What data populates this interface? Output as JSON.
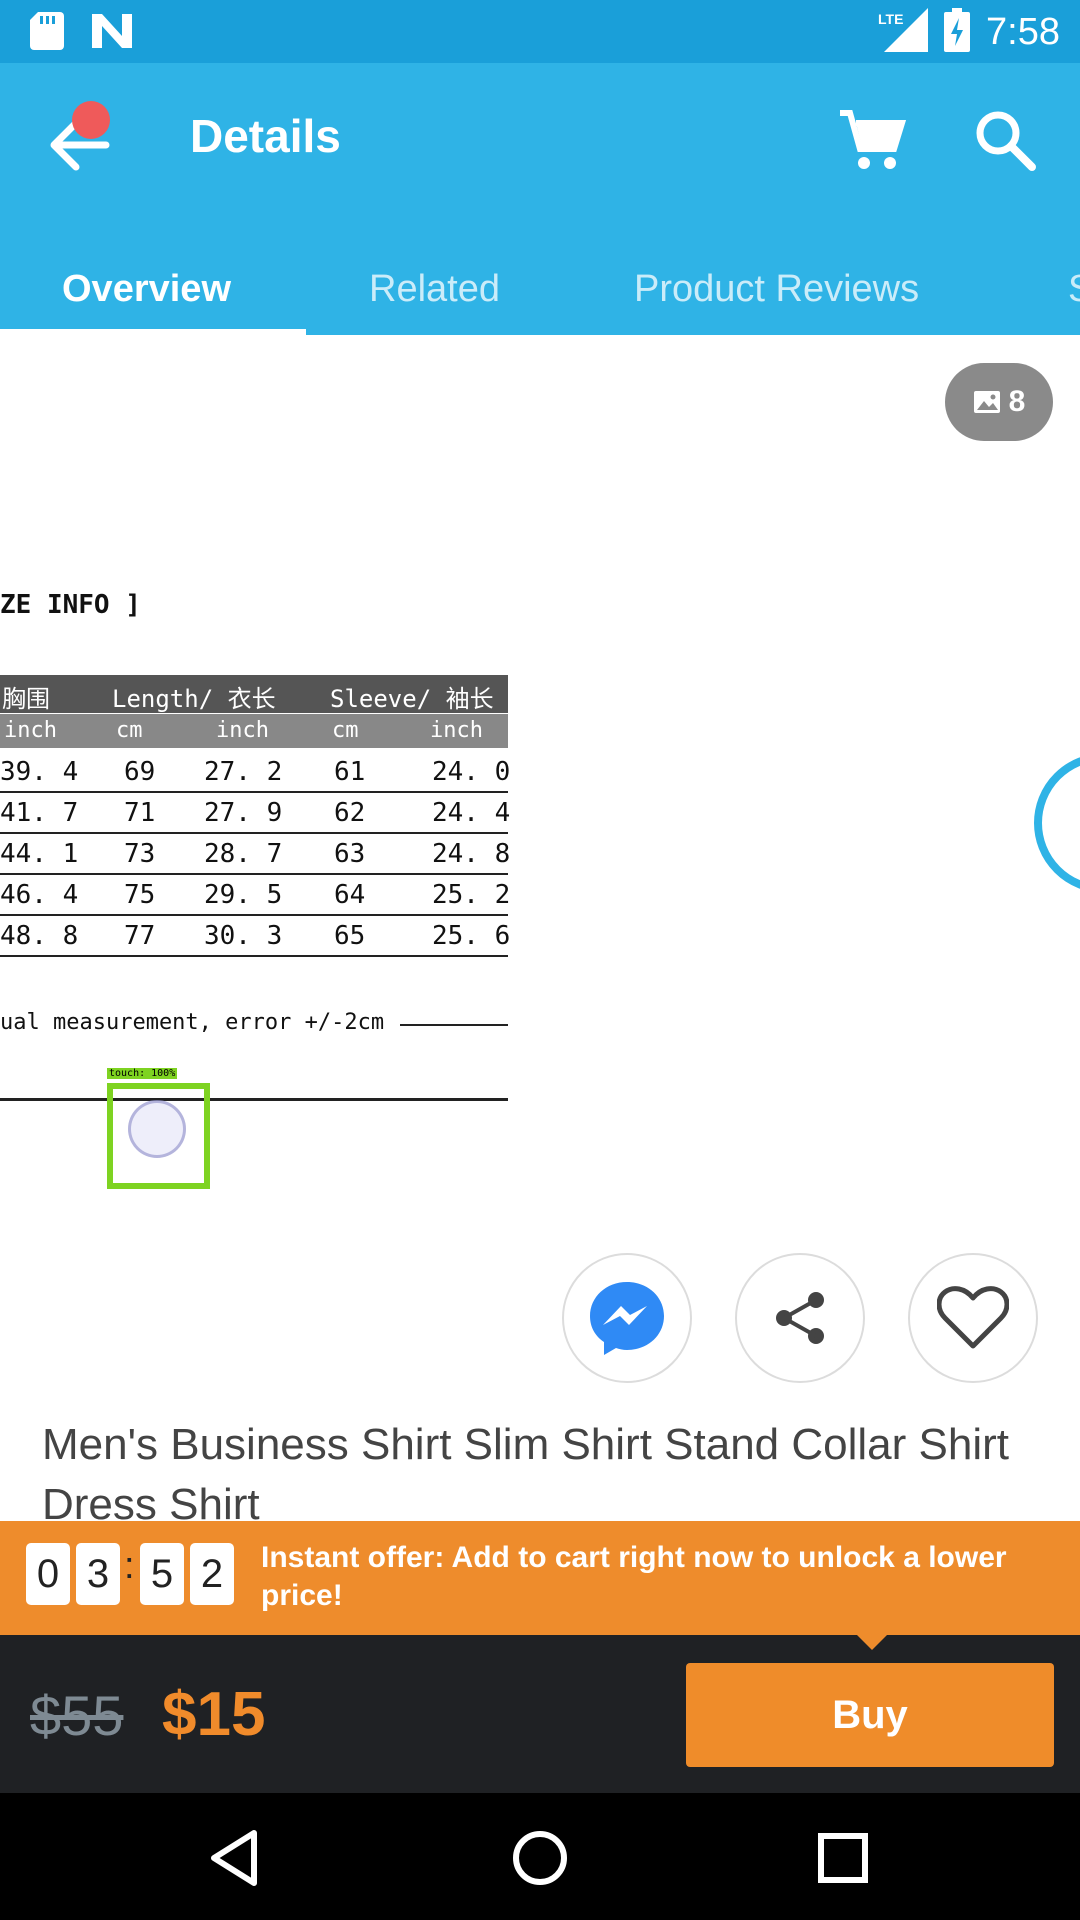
{
  "status_bar": {
    "time": "7:58",
    "network": "LTE",
    "icons": [
      "sd-card-icon",
      "n-notification-icon",
      "signal-icon",
      "battery-charging-icon"
    ]
  },
  "app_bar": {
    "title": "Details",
    "icons": [
      "back-arrow-icon",
      "cart-icon",
      "search-icon"
    ]
  },
  "tabs": [
    {
      "label": "Overview",
      "active": true
    },
    {
      "label": "Related",
      "active": false
    },
    {
      "label": "Product Reviews",
      "active": false
    },
    {
      "label": "S",
      "active": false
    }
  ],
  "gallery": {
    "image_count": "8"
  },
  "size_chart": {
    "title": "ZE INFO ]",
    "header1": [
      "胸围",
      "Length/ 衣长",
      "Sleeve/ 袖长"
    ],
    "header2": [
      "inch",
      "cm",
      "inch",
      "cm",
      "inch"
    ],
    "rows": [
      [
        "39. 4",
        "69",
        "27. 2",
        "61",
        "24. 0"
      ],
      [
        "41. 7",
        "71",
        "27. 9",
        "62",
        "24. 4"
      ],
      [
        "44. 1",
        "73",
        "28. 7",
        "63",
        "24. 8"
      ],
      [
        "46. 4",
        "75",
        "29. 5",
        "64",
        "25. 2"
      ],
      [
        "48. 8",
        "77",
        "30. 3",
        "65",
        "25. 6"
      ]
    ],
    "note": "ual measurement, error +/-2cm"
  },
  "touch_overlay": {
    "label": "touch: 100%"
  },
  "actions": {
    "messenger": "messenger-icon",
    "share": "share-icon",
    "favorite": "heart-icon"
  },
  "product": {
    "title": "Men's Business Shirt Slim Shirt Stand Collar Shirt Dress Shirt"
  },
  "offer": {
    "timer_digits": [
      "0",
      "3",
      "5",
      "2"
    ],
    "separator": ":",
    "text": "Instant offer: Add to cart right now to unlock a lower price!"
  },
  "purchase": {
    "old_price": "$55",
    "new_price": "$15",
    "buy_label": "Buy"
  },
  "colors": {
    "status_bar": "#1a9fd9",
    "app_bar": "#2fb3e6",
    "accent_orange": "#ee8c2c",
    "buy_bar": "#1f2124"
  }
}
